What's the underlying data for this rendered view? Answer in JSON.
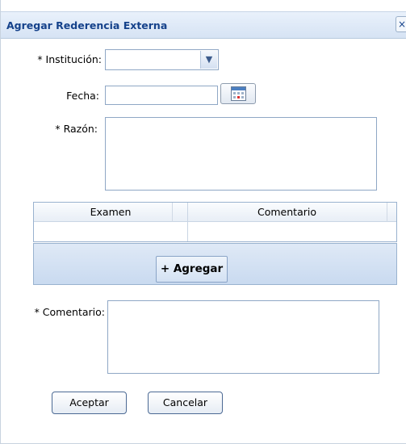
{
  "dialog": {
    "title": "Agregar Rederencia Externa",
    "close_glyph": "×"
  },
  "form": {
    "institucion_label": "Institución:",
    "institucion_value": "",
    "fecha_label": "Fecha:",
    "fecha_value": "",
    "razon_label": "Razón:",
    "razon_value": "",
    "comentario_label": "Comentario:",
    "comentario_value": "",
    "required_mark": "*"
  },
  "grid": {
    "columns": [
      "Examen",
      "Comentario"
    ],
    "add_label": "+ Agregar"
  },
  "buttons": {
    "accept": "Aceptar",
    "cancel": "Cancelar"
  },
  "icons": {
    "calendar": "calendar-icon",
    "dropdown": "chevron-down-icon"
  }
}
